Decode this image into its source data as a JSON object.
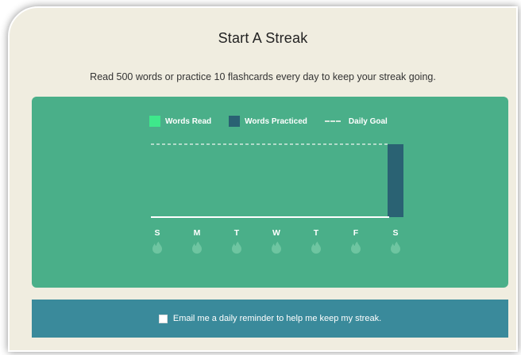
{
  "header": {
    "title": "Start A Streak",
    "subtitle": "Read 500 words or practice 10 flashcards every day to keep your streak going."
  },
  "legend": {
    "words_read": "Words Read",
    "words_practiced": "Words Practiced",
    "daily_goal": "Daily Goal"
  },
  "colors": {
    "words_read": "#3ee88b",
    "words_practiced": "#2a6273",
    "card": "#4aaf89",
    "reminder": "#3a8a9b"
  },
  "chart_data": {
    "type": "bar",
    "categories": [
      "S",
      "M",
      "T",
      "W",
      "T",
      "F",
      "S"
    ],
    "series": [
      {
        "name": "Words Read",
        "values": [
          0,
          0,
          0,
          0,
          0,
          0,
          0
        ]
      },
      {
        "name": "Words Practiced",
        "values": [
          0,
          0,
          0,
          0,
          0,
          0,
          1
        ]
      }
    ],
    "goal": 1,
    "ylim": [
      0,
      1
    ],
    "streak_icons": [
      "flame-icon",
      "flame-icon",
      "flame-icon",
      "flame-icon",
      "flame-icon",
      "flame-icon",
      "flame-icon"
    ]
  },
  "reminder": {
    "checked": false,
    "label": "Email me a daily reminder to help me keep my streak."
  }
}
